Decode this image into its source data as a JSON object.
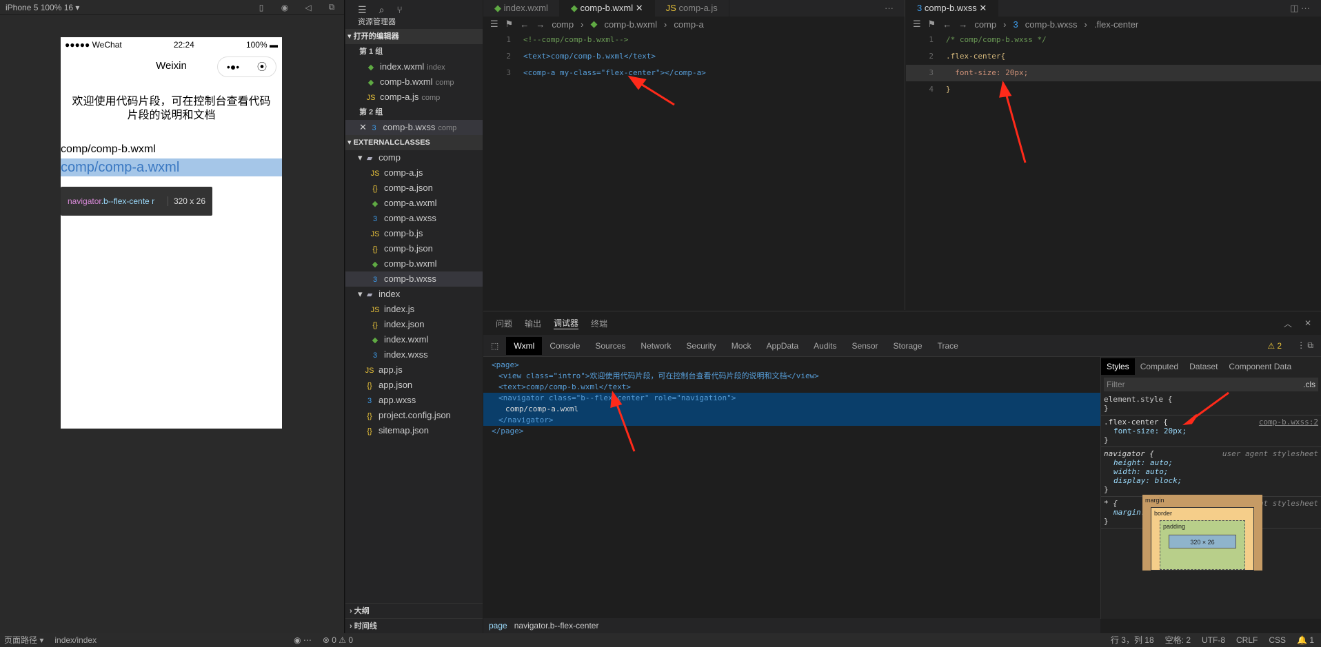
{
  "simulator": {
    "device": "iPhone 5 100% 16 ▾",
    "phone": {
      "carrier": "●●●●● WeChat",
      "time": "22:24",
      "battery": "100%",
      "title": "Weixin",
      "capsule_more": "•●•",
      "intro": "欢迎使用代码片段，可在控制台查看代码片段的说明和文档",
      "text1": "comp/comp-b.wxml",
      "text2": "comp/comp-a.wxml"
    },
    "tooltip": {
      "tag": "navigator",
      "cls": ".b--flex-cente r",
      "size": "320 x 26"
    }
  },
  "explorer": {
    "title": "资源管理器",
    "open_editors": "打开的编辑器",
    "group1": "第 1 组",
    "group2": "第 2 组",
    "open1": [
      {
        "name": "index.wxml",
        "hint": "index",
        "type": "wx"
      },
      {
        "name": "comp-b.wxml",
        "hint": "comp",
        "type": "wx"
      },
      {
        "name": "comp-a.js",
        "hint": "comp",
        "type": "js"
      }
    ],
    "open2": {
      "name": "comp-b.wxss",
      "hint": "comp"
    },
    "project": "EXTERNALCLASSES",
    "comp_folder": "comp",
    "comp_files": [
      {
        "name": "comp-a.js",
        "type": "js",
        "icon": "JS"
      },
      {
        "name": "comp-a.json",
        "type": "json",
        "icon": "{}"
      },
      {
        "name": "comp-a.wxml",
        "type": "wx",
        "icon": "◆"
      },
      {
        "name": "comp-a.wxss",
        "type": "css",
        "icon": "3"
      },
      {
        "name": "comp-b.js",
        "type": "js",
        "icon": "JS"
      },
      {
        "name": "comp-b.json",
        "type": "json",
        "icon": "{}"
      },
      {
        "name": "comp-b.wxml",
        "type": "wx",
        "icon": "◆"
      },
      {
        "name": "comp-b.wxss",
        "type": "css",
        "icon": "3"
      }
    ],
    "index_folder": "index",
    "index_files": [
      {
        "name": "index.js",
        "type": "js",
        "icon": "JS"
      },
      {
        "name": "index.json",
        "type": "json",
        "icon": "{}"
      },
      {
        "name": "index.wxml",
        "type": "wx",
        "icon": "◆"
      },
      {
        "name": "index.wxss",
        "type": "css",
        "icon": "3"
      }
    ],
    "root_files": [
      {
        "name": "app.js",
        "type": "js",
        "icon": "JS"
      },
      {
        "name": "app.json",
        "type": "json",
        "icon": "{}"
      },
      {
        "name": "app.wxss",
        "type": "css",
        "icon": "3"
      },
      {
        "name": "project.config.json",
        "type": "json",
        "icon": "{}"
      },
      {
        "name": "sitemap.json",
        "type": "json",
        "icon": "{}"
      }
    ],
    "outline": "大纲",
    "timeline": "时间线"
  },
  "editorA": {
    "tabs": [
      "index.wxml",
      "comp-b.wxml",
      "comp-a.js"
    ],
    "crumb": [
      "comp",
      "comp-b.wxml",
      "comp-a"
    ],
    "lines": [
      "<!--comp/comp-b.wxml-->",
      "<text>comp/comp-b.wxml</text>",
      "<comp-a my-class=\"flex-center\"></comp-a>"
    ]
  },
  "editorB": {
    "tab": "comp-b.wxss",
    "crumb": [
      "comp",
      "comp-b.wxss",
      ".flex-center"
    ],
    "l1": "/* comp/comp-b.wxss */",
    "l2": ".flex-center{",
    "l3": "font-size: 20px;",
    "l4": "}"
  },
  "debug": {
    "top": [
      "问题",
      "输出",
      "调试器",
      "终端"
    ],
    "tabs": [
      "Wxml",
      "Console",
      "Sources",
      "Network",
      "Security",
      "Mock",
      "AppData",
      "Audits",
      "Sensor",
      "Storage",
      "Trace"
    ],
    "warn": "⚠ 2",
    "dom": [
      "<page>",
      "<view class=\"intro\">欢迎使用代码片段，可在控制台查看代码片段的说明和文档</view>",
      "<text>comp/comp-b.wxml</text>",
      "<navigator class=\"b--flex-center\" role=\"navigation\">",
      "comp/comp-a.wxml",
      "</navigator>",
      "</page>"
    ],
    "path": [
      "page",
      "navigator.b--flex-center"
    ]
  },
  "styles": {
    "tabs": [
      "Styles",
      "Computed",
      "Dataset",
      "Component Data"
    ],
    "filter": "Filter",
    "cls": ".cls",
    "element": "element.style {",
    "sel": ".flex-center {",
    "src": "comp-b.wxss:2",
    "prop": "font-size: 20px;",
    "nav": "navigator {",
    "ua": "user agent stylesheet",
    "navprops": [
      "height: auto;",
      "width: auto;",
      "display: block;"
    ],
    "star": "* {",
    "starprop": "margin: 0;",
    "box": {
      "margin": "margin",
      "border": "border",
      "padding": "padding",
      "content": "320 × 26",
      "dash": "–"
    }
  },
  "statusbar": {
    "path": "页面路径 ▾",
    "page": "index/index",
    "errors": "⊗ 0 ⚠ 0",
    "pos": "行 3，列 18",
    "spaces": "空格: 2",
    "enc": "UTF-8",
    "eol": "CRLF",
    "lang": "CSS",
    "bell": "🔔 1"
  },
  "colors": {
    "accent": "#ff2a1a",
    "selection": "#0a3e6a"
  }
}
